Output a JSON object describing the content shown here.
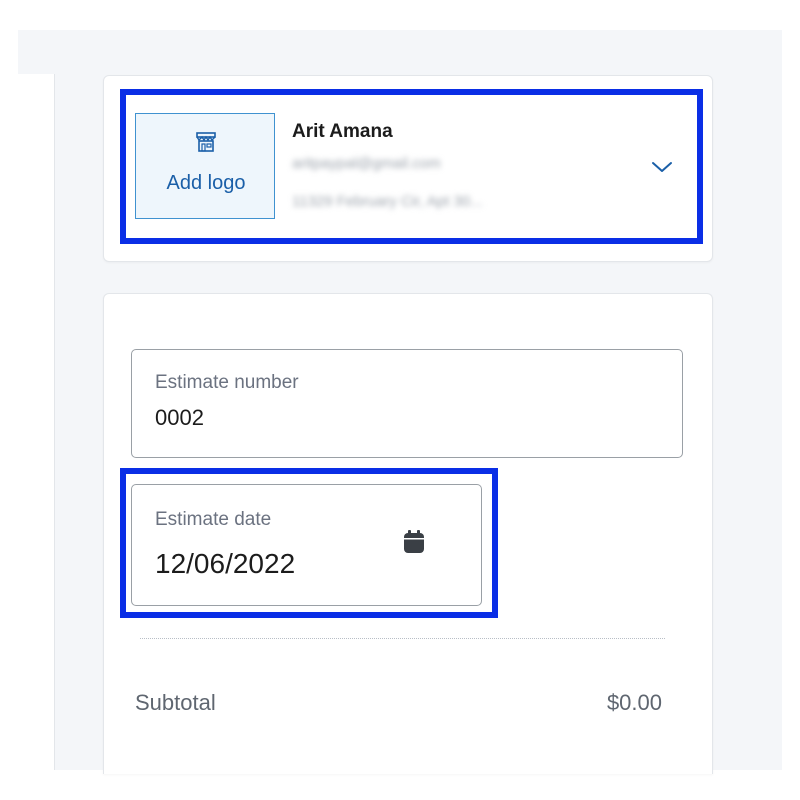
{
  "business": {
    "add_logo_label": "Add logo",
    "name": "Arit Amana",
    "email": "aritpaypal@gmail.com",
    "address": "11329 February Cir, Apt 30..."
  },
  "estimate": {
    "number_label": "Estimate number",
    "number_value": "0002",
    "date_label": "Estimate date",
    "date_value": "12/06/2022"
  },
  "summary": {
    "subtotal_label": "Subtotal",
    "subtotal_value": "$0.00"
  },
  "icons": {
    "store": "store-icon",
    "chevron": "chevron-down-icon",
    "calendar": "calendar-icon"
  },
  "colors": {
    "highlight": "#0a2ee6",
    "accent_blue": "#1a5fa8",
    "logo_border": "#3f92d0",
    "logo_bg": "#eef6fc",
    "background": "#f4f6f9"
  }
}
